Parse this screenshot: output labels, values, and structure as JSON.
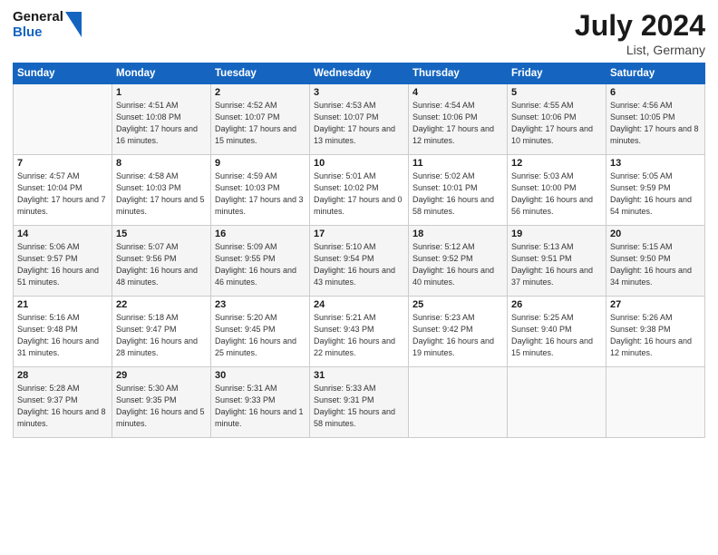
{
  "header": {
    "logo_line1": "General",
    "logo_line2": "Blue",
    "month_year": "July 2024",
    "location": "List, Germany"
  },
  "days_of_week": [
    "Sunday",
    "Monday",
    "Tuesday",
    "Wednesday",
    "Thursday",
    "Friday",
    "Saturday"
  ],
  "weeks": [
    [
      {
        "day": "",
        "info": ""
      },
      {
        "day": "1",
        "info": "Sunrise: 4:51 AM\nSunset: 10:08 PM\nDaylight: 17 hours\nand 16 minutes."
      },
      {
        "day": "2",
        "info": "Sunrise: 4:52 AM\nSunset: 10:07 PM\nDaylight: 17 hours\nand 15 minutes."
      },
      {
        "day": "3",
        "info": "Sunrise: 4:53 AM\nSunset: 10:07 PM\nDaylight: 17 hours\nand 13 minutes."
      },
      {
        "day": "4",
        "info": "Sunrise: 4:54 AM\nSunset: 10:06 PM\nDaylight: 17 hours\nand 12 minutes."
      },
      {
        "day": "5",
        "info": "Sunrise: 4:55 AM\nSunset: 10:06 PM\nDaylight: 17 hours\nand 10 minutes."
      },
      {
        "day": "6",
        "info": "Sunrise: 4:56 AM\nSunset: 10:05 PM\nDaylight: 17 hours\nand 8 minutes."
      }
    ],
    [
      {
        "day": "7",
        "info": "Sunrise: 4:57 AM\nSunset: 10:04 PM\nDaylight: 17 hours\nand 7 minutes."
      },
      {
        "day": "8",
        "info": "Sunrise: 4:58 AM\nSunset: 10:03 PM\nDaylight: 17 hours\nand 5 minutes."
      },
      {
        "day": "9",
        "info": "Sunrise: 4:59 AM\nSunset: 10:03 PM\nDaylight: 17 hours\nand 3 minutes."
      },
      {
        "day": "10",
        "info": "Sunrise: 5:01 AM\nSunset: 10:02 PM\nDaylight: 17 hours\nand 0 minutes."
      },
      {
        "day": "11",
        "info": "Sunrise: 5:02 AM\nSunset: 10:01 PM\nDaylight: 16 hours\nand 58 minutes."
      },
      {
        "day": "12",
        "info": "Sunrise: 5:03 AM\nSunset: 10:00 PM\nDaylight: 16 hours\nand 56 minutes."
      },
      {
        "day": "13",
        "info": "Sunrise: 5:05 AM\nSunset: 9:59 PM\nDaylight: 16 hours\nand 54 minutes."
      }
    ],
    [
      {
        "day": "14",
        "info": "Sunrise: 5:06 AM\nSunset: 9:57 PM\nDaylight: 16 hours\nand 51 minutes."
      },
      {
        "day": "15",
        "info": "Sunrise: 5:07 AM\nSunset: 9:56 PM\nDaylight: 16 hours\nand 48 minutes."
      },
      {
        "day": "16",
        "info": "Sunrise: 5:09 AM\nSunset: 9:55 PM\nDaylight: 16 hours\nand 46 minutes."
      },
      {
        "day": "17",
        "info": "Sunrise: 5:10 AM\nSunset: 9:54 PM\nDaylight: 16 hours\nand 43 minutes."
      },
      {
        "day": "18",
        "info": "Sunrise: 5:12 AM\nSunset: 9:52 PM\nDaylight: 16 hours\nand 40 minutes."
      },
      {
        "day": "19",
        "info": "Sunrise: 5:13 AM\nSunset: 9:51 PM\nDaylight: 16 hours\nand 37 minutes."
      },
      {
        "day": "20",
        "info": "Sunrise: 5:15 AM\nSunset: 9:50 PM\nDaylight: 16 hours\nand 34 minutes."
      }
    ],
    [
      {
        "day": "21",
        "info": "Sunrise: 5:16 AM\nSunset: 9:48 PM\nDaylight: 16 hours\nand 31 minutes."
      },
      {
        "day": "22",
        "info": "Sunrise: 5:18 AM\nSunset: 9:47 PM\nDaylight: 16 hours\nand 28 minutes."
      },
      {
        "day": "23",
        "info": "Sunrise: 5:20 AM\nSunset: 9:45 PM\nDaylight: 16 hours\nand 25 minutes."
      },
      {
        "day": "24",
        "info": "Sunrise: 5:21 AM\nSunset: 9:43 PM\nDaylight: 16 hours\nand 22 minutes."
      },
      {
        "day": "25",
        "info": "Sunrise: 5:23 AM\nSunset: 9:42 PM\nDaylight: 16 hours\nand 19 minutes."
      },
      {
        "day": "26",
        "info": "Sunrise: 5:25 AM\nSunset: 9:40 PM\nDaylight: 16 hours\nand 15 minutes."
      },
      {
        "day": "27",
        "info": "Sunrise: 5:26 AM\nSunset: 9:38 PM\nDaylight: 16 hours\nand 12 minutes."
      }
    ],
    [
      {
        "day": "28",
        "info": "Sunrise: 5:28 AM\nSunset: 9:37 PM\nDaylight: 16 hours\nand 8 minutes."
      },
      {
        "day": "29",
        "info": "Sunrise: 5:30 AM\nSunset: 9:35 PM\nDaylight: 16 hours\nand 5 minutes."
      },
      {
        "day": "30",
        "info": "Sunrise: 5:31 AM\nSunset: 9:33 PM\nDaylight: 16 hours\nand 1 minute."
      },
      {
        "day": "31",
        "info": "Sunrise: 5:33 AM\nSunset: 9:31 PM\nDaylight: 15 hours\nand 58 minutes."
      },
      {
        "day": "",
        "info": ""
      },
      {
        "day": "",
        "info": ""
      },
      {
        "day": "",
        "info": ""
      }
    ]
  ]
}
